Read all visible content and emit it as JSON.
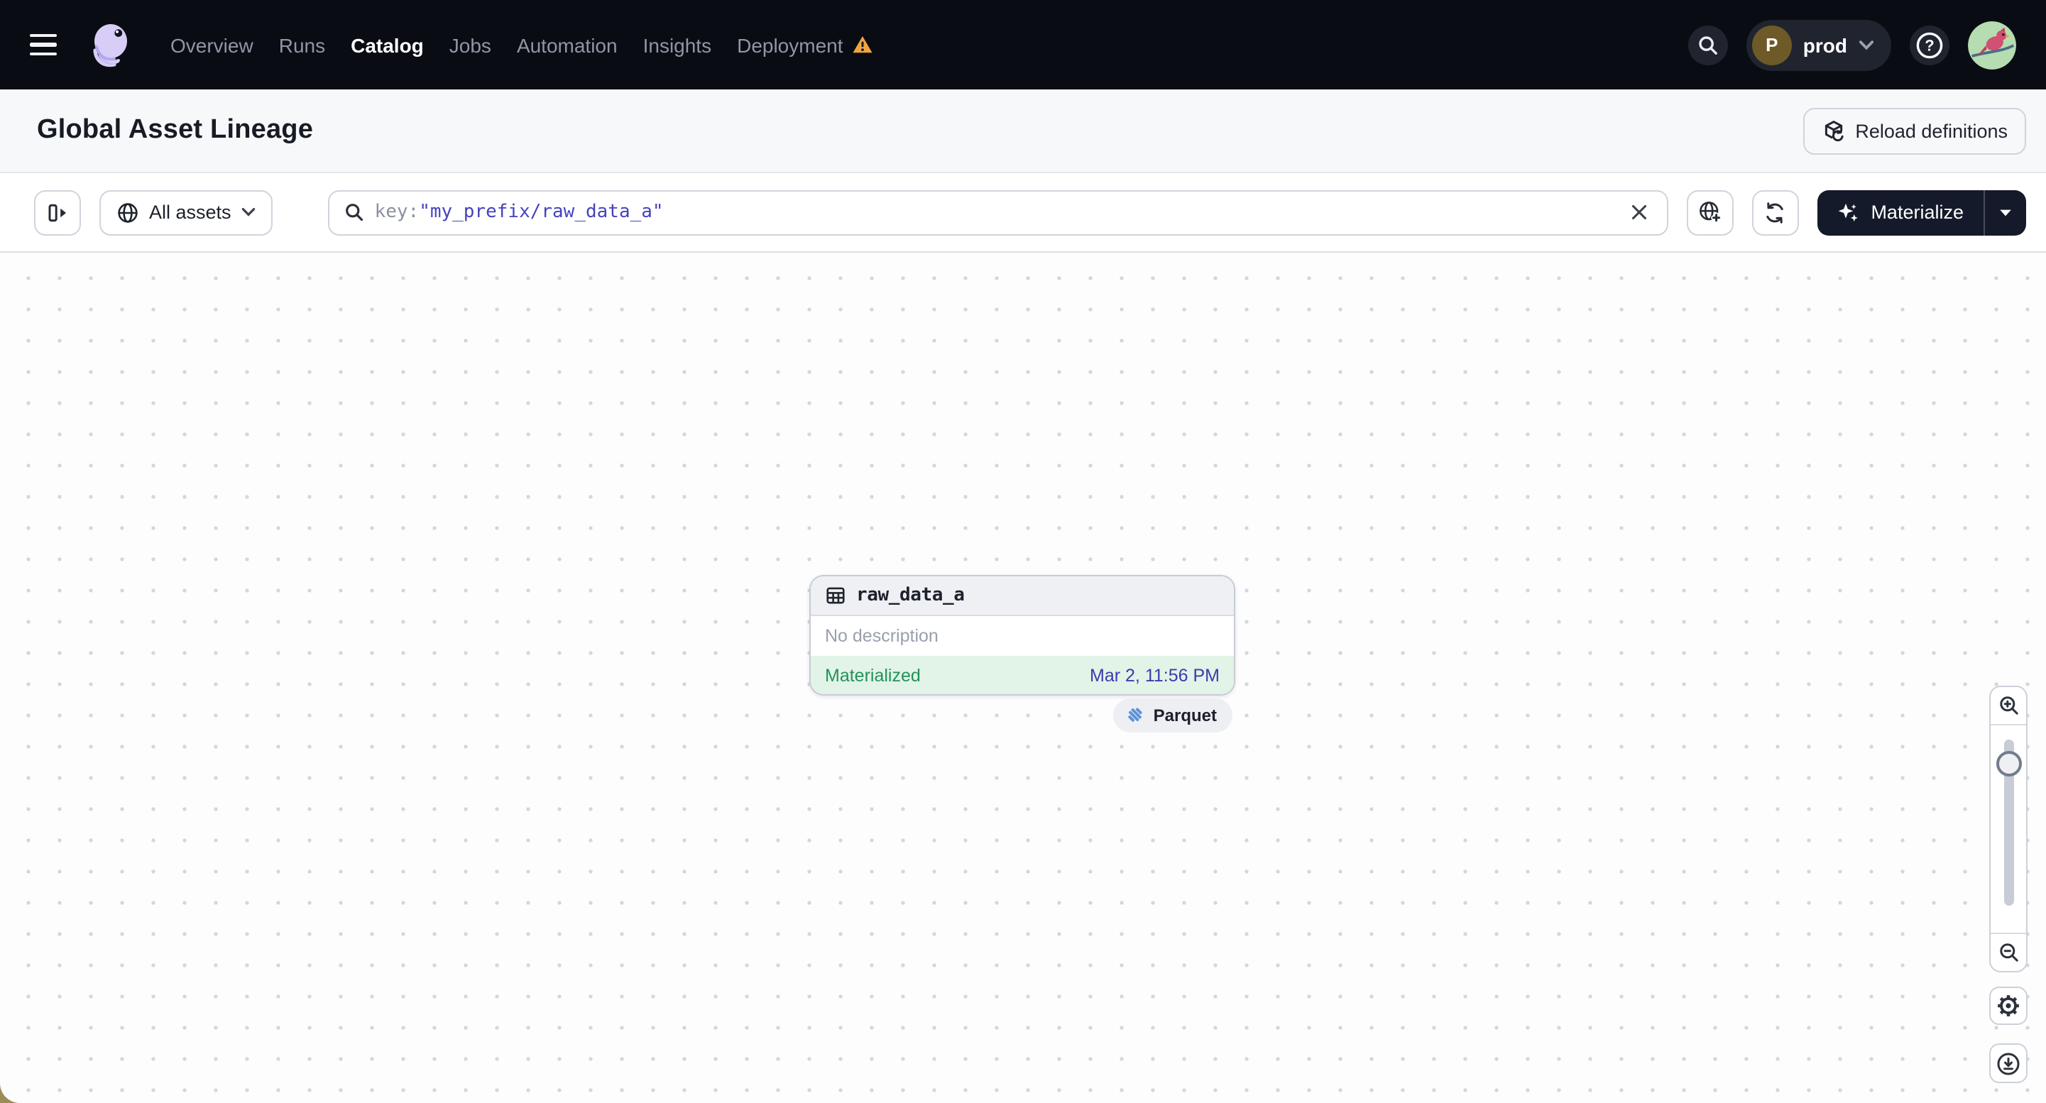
{
  "nav": {
    "menu_items": [
      {
        "label": "Overview"
      },
      {
        "label": "Runs"
      },
      {
        "label": "Catalog"
      },
      {
        "label": "Jobs"
      },
      {
        "label": "Automation"
      },
      {
        "label": "Insights"
      },
      {
        "label": "Deployment"
      }
    ],
    "active_item": "Catalog",
    "deployment_has_warning": true,
    "environment": {
      "initial": "P",
      "name": "prod"
    }
  },
  "header": {
    "title": "Global Asset Lineage",
    "reload_button_label": "Reload definitions"
  },
  "toolbar": {
    "asset_scope_label": "All assets",
    "search": {
      "token_key": "key:",
      "token_value": "\"my_prefix/raw_data_a\""
    },
    "materialize_label": "Materialize"
  },
  "canvas": {
    "asset_node": {
      "name": "raw_data_a",
      "description": "No description",
      "status_label": "Materialized",
      "materialized_at": "Mar 2, 11:56 PM",
      "compute_kind": "Parquet"
    }
  },
  "colors": {
    "nav_bg": "#0a0c13",
    "warning_orange": "#f1a43e",
    "search_value_indigo": "#4643bd",
    "status_green": "#23935a",
    "status_green_bg": "#e2f3e7",
    "timestamp_blue": "#3e39ae",
    "materialize_button_bg": "#141a29",
    "parquet_blue": "#5b93d8"
  }
}
